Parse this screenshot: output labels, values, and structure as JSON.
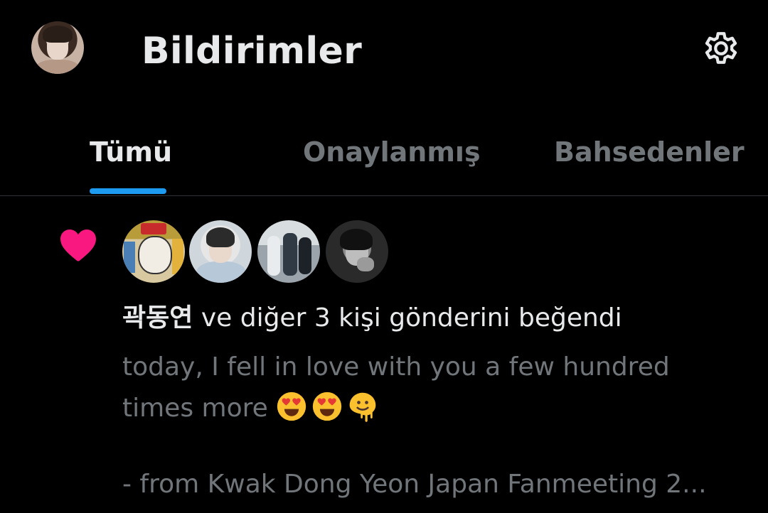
{
  "header": {
    "title": "Bildirimler",
    "avatar_icon": "profile-avatar",
    "settings_icon": "gear-icon"
  },
  "tabs": [
    {
      "label": "Tümü",
      "active": true
    },
    {
      "label": "Onaylanmış",
      "active": false
    },
    {
      "label": "Bahsedenler",
      "active": false
    }
  ],
  "notification": {
    "type_icon": "heart-icon",
    "actor_name": "곽동연",
    "action_text": " ve diğer 3 kişi gönderini beğendi",
    "preview_line1": "today, I fell in love with you a few hundred",
    "preview_line2": "times more ",
    "preview_emojis": [
      "heart-eyes-emoji",
      "heart-eyes-emoji",
      "melting-face-emoji"
    ],
    "preview_line3": "- from Kwak Dong Yeon Japan Fanmeeting 2..."
  },
  "colors": {
    "background": "#000000",
    "text_primary": "#e7e9ea",
    "text_secondary": "#71767b",
    "accent": "#1d9bf0",
    "like": "#f91880"
  }
}
